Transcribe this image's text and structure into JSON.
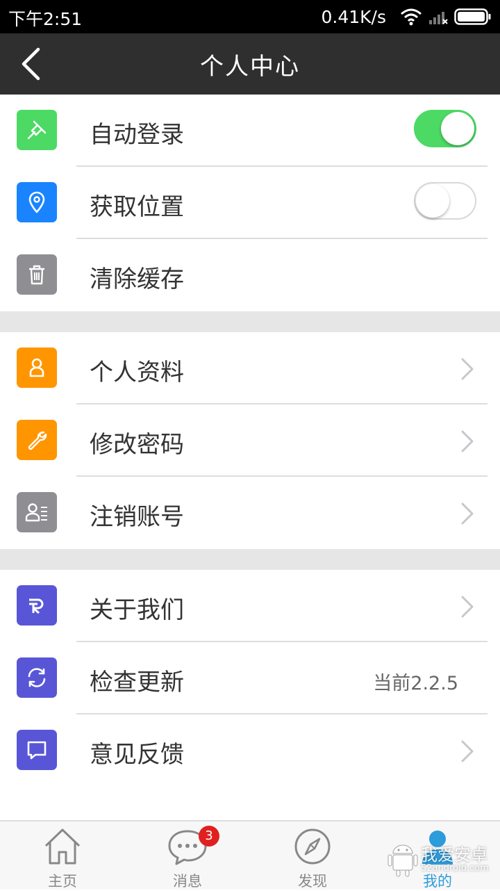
{
  "status_bar": {
    "time": "下午2:51",
    "speed": "0.41K/s",
    "icons": [
      "wifi-icon",
      "cellular-signal-icon",
      "battery-icon"
    ]
  },
  "nav": {
    "title": "个人中心",
    "back_icon": "back-chevron-icon"
  },
  "groups": [
    {
      "rows": [
        {
          "label": "自动登录",
          "icon": "pin-icon",
          "icon_color": "#4cd964",
          "control": "switch",
          "switch_on": true
        },
        {
          "label": "获取位置",
          "icon": "location-icon",
          "icon_color": "#1a84ff",
          "control": "switch",
          "switch_on": false
        },
        {
          "label": "清除缓存",
          "icon": "trash-icon",
          "icon_color": "#8e8e93",
          "control": "none"
        }
      ]
    },
    {
      "rows": [
        {
          "label": "个人资料",
          "icon": "profile-icon",
          "icon_color": "#ff9500",
          "control": "chevron"
        },
        {
          "label": "修改密码",
          "icon": "wrench-icon",
          "icon_color": "#ff9500",
          "control": "chevron"
        },
        {
          "label": "注销账号",
          "icon": "account-list-icon",
          "icon_color": "#8e8e93",
          "control": "chevron"
        }
      ]
    },
    {
      "rows": [
        {
          "label": "关于我们",
          "icon": "logo-r-icon",
          "icon_color": "#5856d6",
          "control": "chevron"
        },
        {
          "label": "检查更新",
          "icon": "refresh-icon",
          "icon_color": "#5856d6",
          "control": "value",
          "value": "当前2.2.5"
        },
        {
          "label": "意见反馈",
          "icon": "chat-bubble-icon",
          "icon_color": "#5856d6",
          "control": "chevron"
        }
      ]
    }
  ],
  "tabs": [
    {
      "label": "主页",
      "icon": "home-icon",
      "active": false
    },
    {
      "label": "消息",
      "icon": "message-icon",
      "active": false,
      "badge": "3"
    },
    {
      "label": "发现",
      "icon": "compass-icon",
      "active": false
    },
    {
      "label": "我的",
      "icon": "user-icon",
      "active": true
    }
  ],
  "colors": {
    "nav_bg": "#2f2f2f",
    "switch_on": "#4cd964",
    "active_tab": "#2d9cdb",
    "badge": "#e02020"
  },
  "watermark": {
    "text": "我爱安卓",
    "sub": "52android.com"
  }
}
